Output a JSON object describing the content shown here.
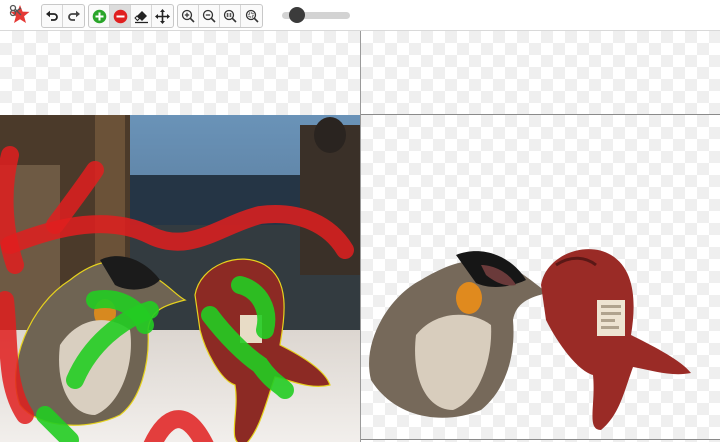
{
  "app": {
    "logo": "scissors-star-logo"
  },
  "toolbar": {
    "history": [
      {
        "name": "undo",
        "icon": "undo-icon"
      },
      {
        "name": "redo",
        "icon": "redo-icon"
      }
    ],
    "tools": [
      {
        "name": "keep-brush",
        "icon": "plus-circle-icon",
        "color": "#2aa52a"
      },
      {
        "name": "remove-brush",
        "icon": "minus-circle-icon",
        "color": "#e02020",
        "active": true
      },
      {
        "name": "eraser",
        "icon": "eraser-icon"
      },
      {
        "name": "move",
        "icon": "move-arrows-icon"
      }
    ],
    "view": [
      {
        "name": "zoom-in",
        "icon": "zoom-in-icon"
      },
      {
        "name": "zoom-out",
        "icon": "zoom-out-icon"
      },
      {
        "name": "zoom-actual",
        "icon": "zoom-1to1-icon"
      },
      {
        "name": "zoom-fit",
        "icon": "zoom-fit-icon"
      }
    ],
    "brush_size_level": 0.22
  },
  "colors": {
    "keep_stroke": "#22cc22",
    "remove_stroke": "#e01e1e",
    "selection_outline": "#e6d21e"
  }
}
